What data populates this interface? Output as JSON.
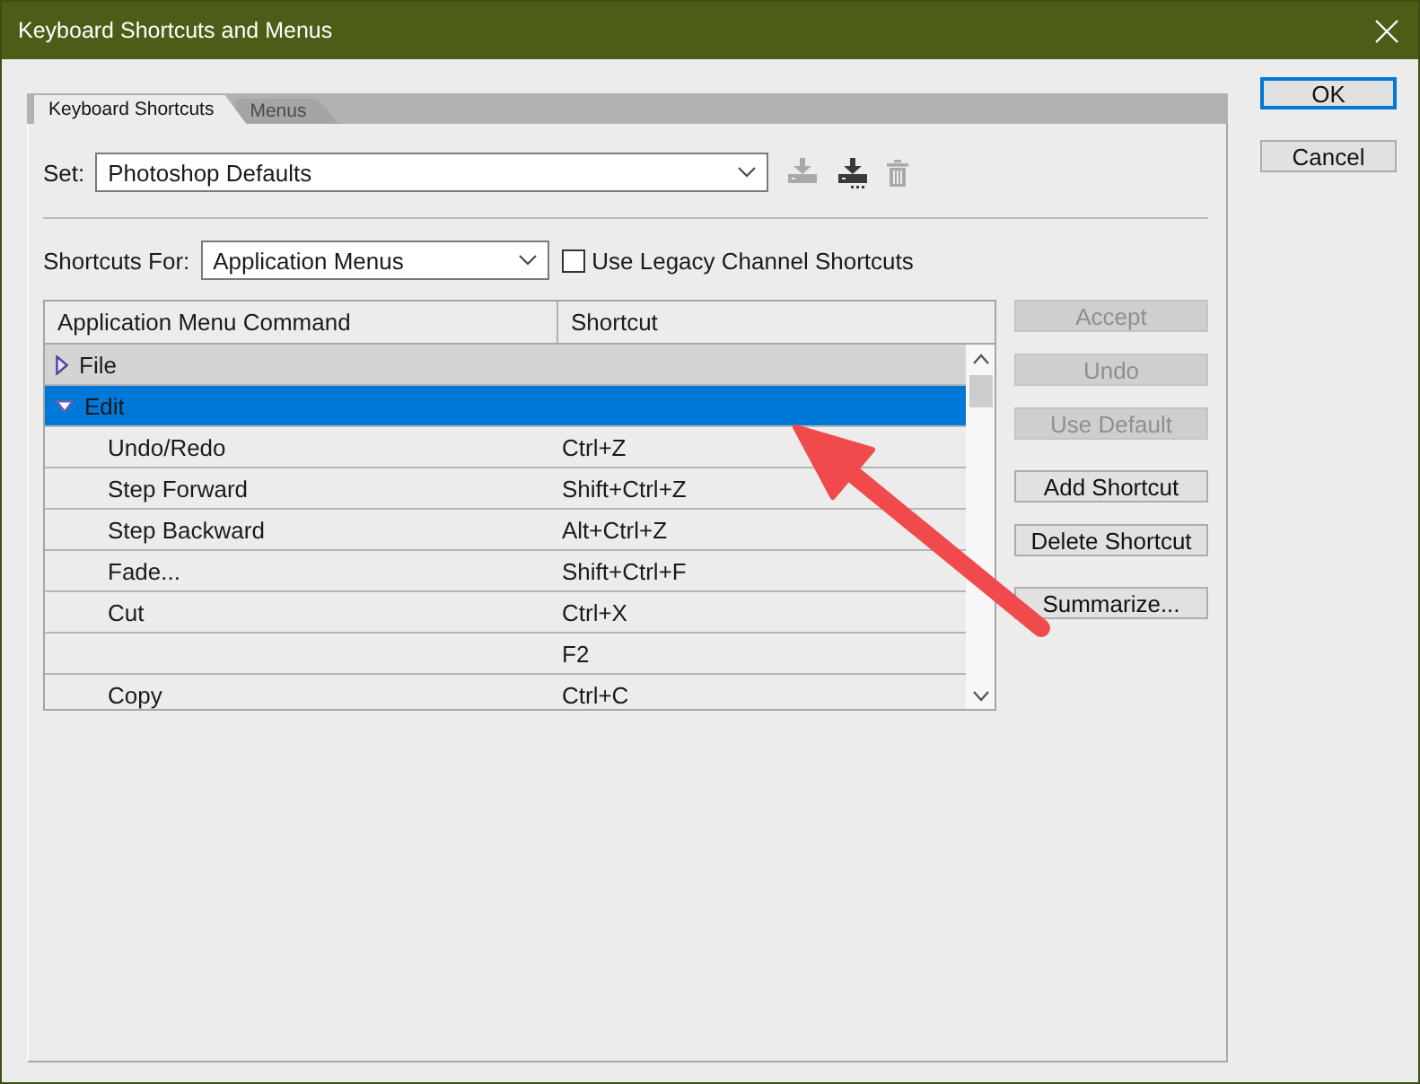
{
  "window": {
    "title": "Keyboard Shortcuts and Menus"
  },
  "tabs": [
    {
      "label": "Keyboard Shortcuts",
      "selected": true
    },
    {
      "label": "Menus",
      "selected": false
    }
  ],
  "set": {
    "label": "Set:",
    "value": "Photoshop Defaults",
    "actions": [
      {
        "kind": "load",
        "disabled": true
      },
      {
        "kind": "save",
        "disabled": false
      },
      {
        "kind": "delete",
        "disabled": true
      }
    ]
  },
  "shortcuts_for": {
    "label": "Shortcuts For:",
    "value": "Application Menus",
    "legacy": {
      "label": "Use Legacy Channel Shortcuts",
      "checked": false
    }
  },
  "table": {
    "columns": [
      "Application Menu Command",
      "Shortcut"
    ],
    "rows": [
      {
        "command": "File",
        "expanded": false,
        "selected": false
      },
      {
        "command": "Edit",
        "expanded": true,
        "selected": true,
        "children": [
          {
            "command": "Undo/Redo",
            "shortcut": "Ctrl+Z",
            "selected": false
          },
          {
            "command": "Step Forward",
            "shortcut": "Shift+Ctrl+Z",
            "selected": false
          },
          {
            "command": "Step Backward",
            "shortcut": "Alt+Ctrl+Z",
            "selected": false
          },
          {
            "command": "Fade...",
            "shortcut": "Shift+Ctrl+F",
            "selected": false
          },
          {
            "command": "Cut",
            "shortcut": "Ctrl+X",
            "selected": false
          },
          {
            "shortcut": "F2",
            "selected": false
          },
          {
            "command": "Copy",
            "shortcut": "Ctrl+C",
            "selected": false
          }
        ]
      }
    ]
  },
  "side_buttons": [
    [
      {
        "label": "Accept",
        "disabled": true
      },
      {
        "label": "Undo",
        "disabled": true
      },
      {
        "label": "Use Default",
        "disabled": true
      }
    ],
    [
      {
        "label": "Add Shortcut",
        "disabled": false
      },
      {
        "label": "Delete Shortcut",
        "disabled": false
      }
    ],
    [
      {
        "label": "Summarize...",
        "disabled": false
      }
    ]
  ],
  "dialog_buttons": [
    {
      "label": "OK",
      "default": true
    },
    {
      "label": "Cancel",
      "default": false
    }
  ],
  "annotation": {
    "kind": "arrow"
  }
}
